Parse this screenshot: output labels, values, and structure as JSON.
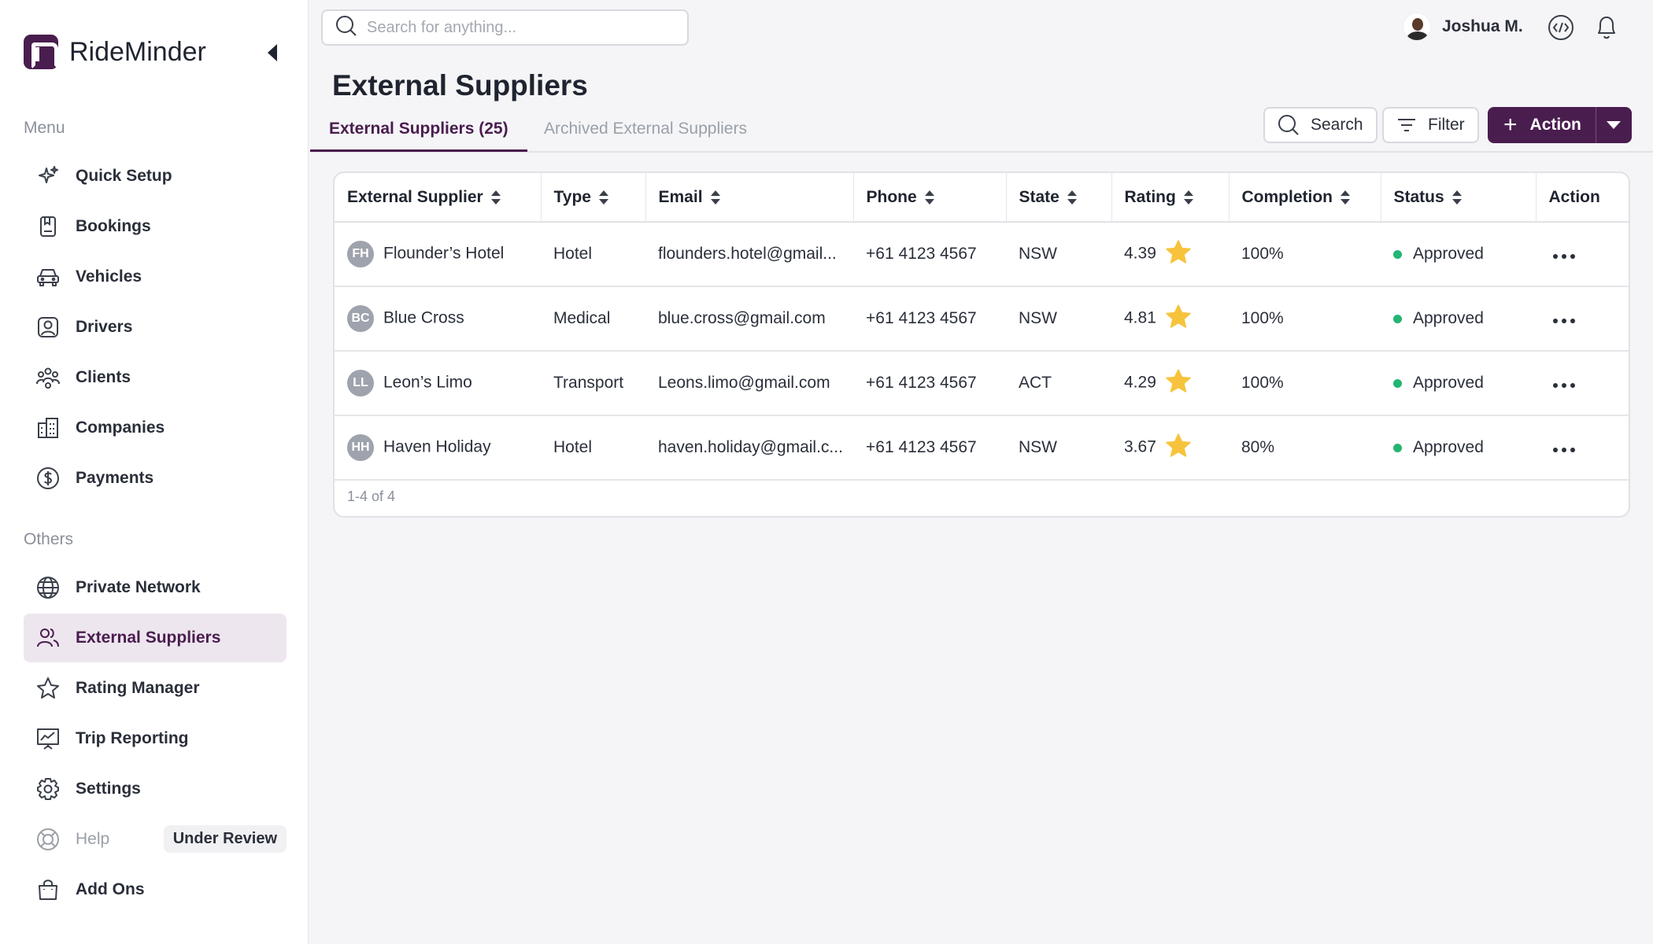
{
  "app": {
    "name": "RideMinder"
  },
  "sidebar": {
    "menu_label": "Menu",
    "others_label": "Others",
    "menu_items": [
      {
        "label": "Quick Setup",
        "icon": "sparkles-icon"
      },
      {
        "label": "Bookings",
        "icon": "booking-icon"
      },
      {
        "label": "Vehicles",
        "icon": "car-icon"
      },
      {
        "label": "Drivers",
        "icon": "driver-icon"
      },
      {
        "label": "Clients",
        "icon": "clients-icon"
      },
      {
        "label": "Companies",
        "icon": "building-icon"
      },
      {
        "label": "Payments",
        "icon": "dollar-icon"
      }
    ],
    "other_items": [
      {
        "label": "Private Network",
        "icon": "globe-icon"
      },
      {
        "label": "External Suppliers",
        "icon": "users-icon",
        "active": true
      },
      {
        "label": "Rating Manager",
        "icon": "star-icon"
      },
      {
        "label": "Trip Reporting",
        "icon": "chart-icon"
      },
      {
        "label": "Settings",
        "icon": "gear-icon"
      },
      {
        "label": "Help",
        "icon": "lifebuoy-icon",
        "badge": "Under Review"
      },
      {
        "label": "Add Ons",
        "icon": "bag-icon"
      }
    ]
  },
  "header": {
    "search_placeholder": "Search for anything...",
    "user_name": "Joshua M."
  },
  "page": {
    "title": "External Suppliers",
    "tabs": [
      {
        "label": "External Suppliers (25)",
        "active": true
      },
      {
        "label": "Archived External Suppliers",
        "active": false
      }
    ],
    "search_button": "Search",
    "filter_button": "Filter",
    "action_button": "Action"
  },
  "table": {
    "columns": [
      "External Supplier",
      "Type",
      "Email",
      "Phone",
      "State",
      "Rating",
      "Completion",
      "Status",
      "Action"
    ],
    "rows": [
      {
        "initials": "FH",
        "name": "Flounder’s Hotel",
        "type": "Hotel",
        "email": "flounders.hotel@gmail...",
        "phone": "+61 4123 4567",
        "state": "NSW",
        "rating": "4.39",
        "completion": "100%",
        "status": "Approved"
      },
      {
        "initials": "BC",
        "name": "Blue Cross",
        "type": "Medical",
        "email": "blue.cross@gmail.com",
        "phone": "+61 4123 4567",
        "state": "NSW",
        "rating": "4.81",
        "completion": "100%",
        "status": "Approved"
      },
      {
        "initials": "LL",
        "name": "Leon’s Limo",
        "type": "Transport",
        "email": "Leons.limo@gmail.com",
        "phone": "+61 4123 4567",
        "state": "ACT",
        "rating": "4.29",
        "completion": "100%",
        "status": "Approved"
      },
      {
        "initials": "HH",
        "name": "Haven Holiday",
        "type": "Hotel",
        "email": "haven.holiday@gmail.c...",
        "phone": "+61 4123 4567",
        "state": "NSW",
        "rating": "3.67",
        "completion": "80%",
        "status": "Approved"
      }
    ],
    "footer": "1-4 of 4"
  },
  "colors": {
    "brand": "#4a1d4f",
    "active_bg": "#ede6ee",
    "status_approved": "#22b573",
    "star": "#f7c33c"
  }
}
